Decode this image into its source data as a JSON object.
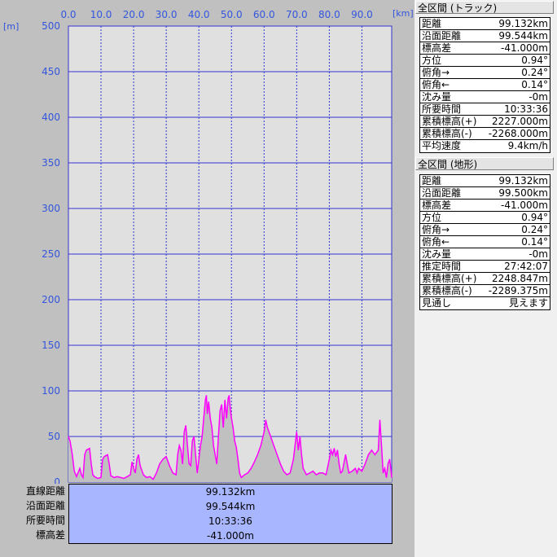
{
  "axis_units": {
    "x": "[km]",
    "y": "[m]"
  },
  "chart_data": {
    "type": "area",
    "xlabel": "[km]",
    "ylabel": "[m]",
    "xlim": [
      0,
      99.132
    ],
    "ylim": [
      0,
      500
    ],
    "x_ticks": [
      "0.0",
      "10.0",
      "20.0",
      "30.0",
      "40.0",
      "50.0",
      "60.0",
      "70.0",
      "80.0",
      "90.0"
    ],
    "y_ticks": [
      "500",
      "450",
      "400",
      "350",
      "300",
      "250",
      "200",
      "150",
      "100",
      "50",
      "0"
    ],
    "grid": true,
    "colors": {
      "line": "#ff00ff",
      "fill": "#c0c0c0",
      "plot_bg": "#e0e0e0",
      "grid": "#3333cc"
    },
    "series": [
      {
        "points": [
          [
            0,
            50
          ],
          [
            0.5,
            45
          ],
          [
            1.2,
            30
          ],
          [
            1.8,
            12
          ],
          [
            2.5,
            6
          ],
          [
            3.5,
            15
          ],
          [
            4,
            8
          ],
          [
            4.5,
            5
          ],
          [
            5,
            30
          ],
          [
            5.5,
            35
          ],
          [
            6.5,
            37
          ],
          [
            7,
            20
          ],
          [
            7.5,
            8
          ],
          [
            8,
            6
          ],
          [
            9,
            4
          ],
          [
            10,
            5
          ],
          [
            10.5,
            25
          ],
          [
            11,
            28
          ],
          [
            12,
            30
          ],
          [
            12.5,
            20
          ],
          [
            13,
            7
          ],
          [
            14,
            5
          ],
          [
            15,
            6
          ],
          [
            16,
            5
          ],
          [
            17,
            4
          ],
          [
            18,
            6
          ],
          [
            19,
            8
          ],
          [
            19.5,
            22
          ],
          [
            20,
            15
          ],
          [
            20.5,
            10
          ],
          [
            21,
            25
          ],
          [
            21.5,
            30
          ],
          [
            22,
            18
          ],
          [
            23,
            8
          ],
          [
            24,
            5
          ],
          [
            25,
            6
          ],
          [
            26,
            3
          ],
          [
            27,
            10
          ],
          [
            28,
            20
          ],
          [
            29,
            25
          ],
          [
            30,
            28
          ],
          [
            31,
            18
          ],
          [
            32,
            10
          ],
          [
            33,
            8
          ],
          [
            33.5,
            30
          ],
          [
            34,
            40
          ],
          [
            34.5,
            35
          ],
          [
            35,
            20
          ],
          [
            35.5,
            55
          ],
          [
            36,
            62
          ],
          [
            36.5,
            40
          ],
          [
            37,
            20
          ],
          [
            37.5,
            18
          ],
          [
            38,
            45
          ],
          [
            38.5,
            50
          ],
          [
            39,
            30
          ],
          [
            39.5,
            10
          ],
          [
            40,
            25
          ],
          [
            40.5,
            40
          ],
          [
            41,
            50
          ],
          [
            41.5,
            70
          ],
          [
            42,
            90
          ],
          [
            42.3,
            95
          ],
          [
            42.6,
            75
          ],
          [
            43,
            88
          ],
          [
            43.5,
            70
          ],
          [
            44,
            60
          ],
          [
            44.5,
            40
          ],
          [
            45,
            30
          ],
          [
            45.5,
            20
          ],
          [
            46,
            50
          ],
          [
            46.5,
            78
          ],
          [
            47,
            85
          ],
          [
            47.5,
            60
          ],
          [
            48,
            90
          ],
          [
            48.5,
            70
          ],
          [
            49,
            92
          ],
          [
            49.3,
            95
          ],
          [
            49.6,
            82
          ],
          [
            50,
            70
          ],
          [
            50.5,
            60
          ],
          [
            51,
            45
          ],
          [
            51.5,
            38
          ],
          [
            52,
            25
          ],
          [
            52.5,
            10
          ],
          [
            53,
            5
          ],
          [
            54,
            8
          ],
          [
            55,
            10
          ],
          [
            56,
            15
          ],
          [
            57,
            22
          ],
          [
            58,
            30
          ],
          [
            59,
            40
          ],
          [
            60,
            55
          ],
          [
            60.5,
            68
          ],
          [
            61,
            60
          ],
          [
            62,
            50
          ],
          [
            63,
            40
          ],
          [
            64,
            30
          ],
          [
            65,
            20
          ],
          [
            66,
            12
          ],
          [
            67,
            8
          ],
          [
            68,
            10
          ],
          [
            69,
            25
          ],
          [
            70,
            55
          ],
          [
            70.5,
            35
          ],
          [
            71,
            50
          ],
          [
            71.5,
            30
          ],
          [
            72,
            15
          ],
          [
            73,
            8
          ],
          [
            74,
            10
          ],
          [
            75,
            12
          ],
          [
            76,
            8
          ],
          [
            77,
            10
          ],
          [
            78,
            10
          ],
          [
            79,
            8
          ],
          [
            80,
            25
          ],
          [
            80.5,
            35
          ],
          [
            81,
            30
          ],
          [
            81.5,
            37
          ],
          [
            82,
            28
          ],
          [
            82.5,
            35
          ],
          [
            83,
            20
          ],
          [
            83.5,
            10
          ],
          [
            84,
            12
          ],
          [
            85,
            30
          ],
          [
            85.5,
            20
          ],
          [
            86,
            10
          ],
          [
            87,
            12
          ],
          [
            88,
            15
          ],
          [
            88.5,
            10
          ],
          [
            89,
            15
          ],
          [
            90,
            12
          ],
          [
            91,
            20
          ],
          [
            92,
            30
          ],
          [
            93,
            35
          ],
          [
            94,
            30
          ],
          [
            95,
            35
          ],
          [
            95.5,
            68
          ],
          [
            96,
            40
          ],
          [
            96.5,
            10
          ],
          [
            97,
            15
          ],
          [
            97.5,
            5
          ],
          [
            98,
            20
          ],
          [
            98.5,
            25
          ],
          [
            99,
            10
          ],
          [
            99.132,
            5
          ]
        ]
      }
    ]
  },
  "summary": [
    {
      "label": "直線距離",
      "value": "99.132km"
    },
    {
      "label": "沿面距離",
      "value": "99.544km"
    },
    {
      "label": "所要時間",
      "value": "10:33:36"
    },
    {
      "label": "標高差",
      "value": "-41.000m"
    }
  ],
  "track_panel": {
    "title": "全区間 (トラック)",
    "rows": [
      {
        "k": "距離",
        "v": "99.132km"
      },
      {
        "k": "沿面距離",
        "v": "99.544km"
      },
      {
        "k": "標高差",
        "v": "-41.000m"
      },
      {
        "k": "方位",
        "v": "0.94°"
      },
      {
        "k": "俯角→",
        "v": "0.24°"
      },
      {
        "k": "俯角←",
        "v": "0.14°"
      },
      {
        "k": "沈み量",
        "v": "-0m"
      },
      {
        "k": "所要時間",
        "v": "10:33:36"
      },
      {
        "k": "累積標高(+)",
        "v": "2227.000m"
      },
      {
        "k": "累積標高(-)",
        "v": "-2268.000m"
      },
      {
        "k": "平均速度",
        "v": "9.4km/h"
      }
    ]
  },
  "terrain_panel": {
    "title": "全区間 (地形)",
    "rows": [
      {
        "k": "距離",
        "v": "99.132km"
      },
      {
        "k": "沿面距離",
        "v": "99.500km"
      },
      {
        "k": "標高差",
        "v": "-41.000m"
      },
      {
        "k": "方位",
        "v": "0.94°"
      },
      {
        "k": "俯角→",
        "v": "0.24°"
      },
      {
        "k": "俯角←",
        "v": "0.14°"
      },
      {
        "k": "沈み量",
        "v": "-0m"
      },
      {
        "k": "推定時間",
        "v": "27:42:07"
      },
      {
        "k": "累積標高(+)",
        "v": "2248.847m"
      },
      {
        "k": "累積標高(-)",
        "v": "-2289.375m"
      },
      {
        "k": "見通し",
        "v": "見えます"
      }
    ]
  }
}
